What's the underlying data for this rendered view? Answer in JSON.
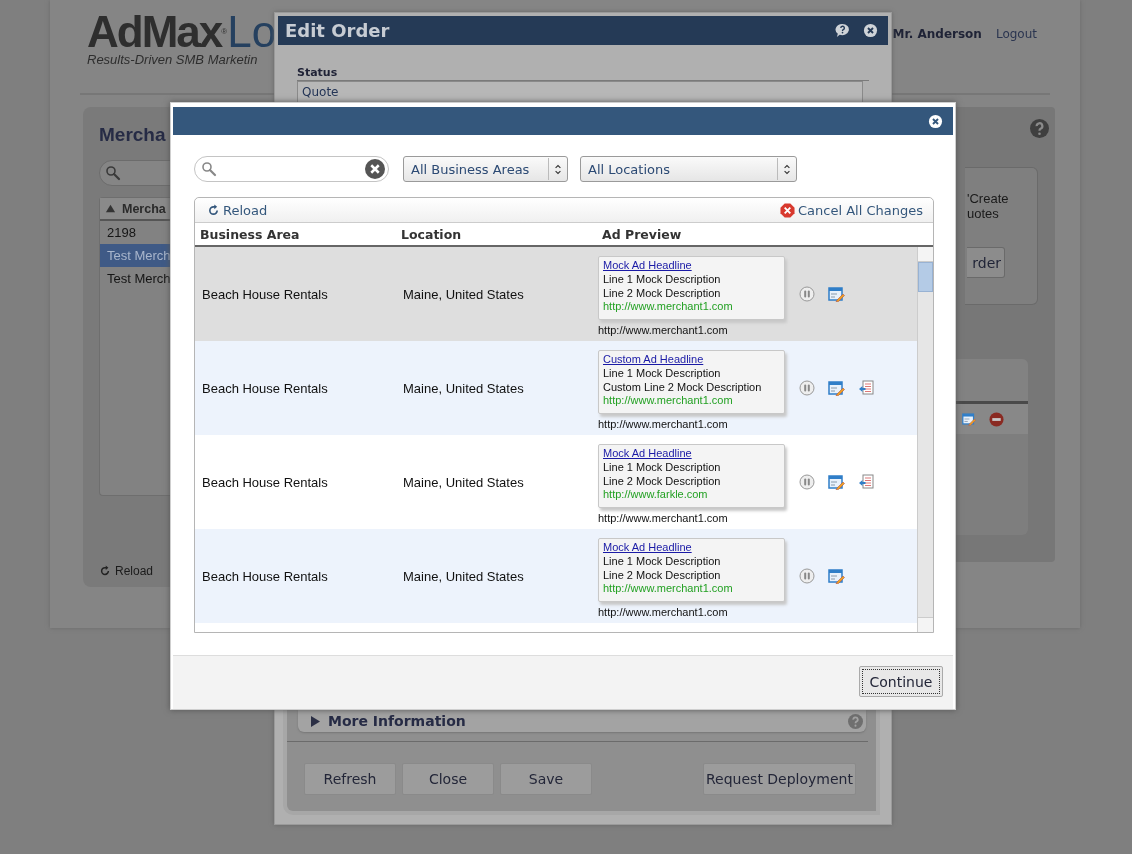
{
  "background_page": {
    "logo": {
      "brand": "AdMax",
      "mark": "®",
      "suffix": "Lo",
      "tagline": "Results-Driven SMB Marketin"
    },
    "user": "Mr. Anderson",
    "logout": "Logout",
    "merchants_panel": {
      "title": "Mercha",
      "list_header": "Mercha",
      "rows": [
        {
          "label": "2198",
          "selected": false
        },
        {
          "label": "Test Merch",
          "selected": true
        },
        {
          "label": "Test Merch",
          "selected": false
        }
      ],
      "reload": "Reload"
    },
    "right_panel": {
      "text_lines": [
        "'Create",
        "uotes"
      ],
      "button": "rder"
    }
  },
  "edit_order": {
    "title": "Edit Order",
    "status_label": "Status",
    "status_value": "Quote",
    "more_information": {
      "label": "More Information",
      "expanded": false
    },
    "buttons": [
      "Refresh",
      "Close",
      "Save"
    ],
    "deploy_button": "Request Deployment"
  },
  "modal": {
    "business_area_filter": "All Business Areas",
    "location_filter": "All Locations",
    "toolbar": {
      "reload": "Reload",
      "cancel": "Cancel All Changes"
    },
    "columns": [
      "Business Area",
      "Location",
      "Ad Preview"
    ],
    "rows": [
      {
        "business_area": "Beach House Rentals",
        "location": "Maine, United States",
        "headline": "Mock Ad Headline",
        "line_1": "Line 1 Mock Description",
        "line_2": "Line 2 Mock Description",
        "url": "http://www.merchant1.com",
        "display_url": "http://www.merchant1.com",
        "revertible": false,
        "selected": true
      },
      {
        "business_area": "Beach House Rentals",
        "location": "Maine, United States",
        "headline": "Custom Ad Headline",
        "line_1": "Line 1 Mock Description",
        "line_2": "Custom Line 2 Mock Description",
        "url": "http://www.merchant1.com",
        "display_url": "http://www.merchant1.com",
        "revertible": true,
        "selected": false
      },
      {
        "business_area": "Beach House Rentals",
        "location": "Maine, United States",
        "headline": "Mock Ad Headline",
        "line_1": "Line 1 Mock Description",
        "line_2": "Line 2 Mock Description",
        "url": "http://www.farkle.com",
        "display_url": "http://www.merchant1.com",
        "revertible": true,
        "selected": false
      },
      {
        "business_area": "Beach House Rentals",
        "location": "Maine, United States",
        "headline": "Mock Ad Headline",
        "line_1": "Line 1 Mock Description",
        "line_2": "Line 2 Mock Description",
        "url": "http://www.merchant1.com",
        "display_url": "http://www.merchant1.com",
        "revertible": false,
        "selected": false
      }
    ],
    "continue": "Continue"
  }
}
